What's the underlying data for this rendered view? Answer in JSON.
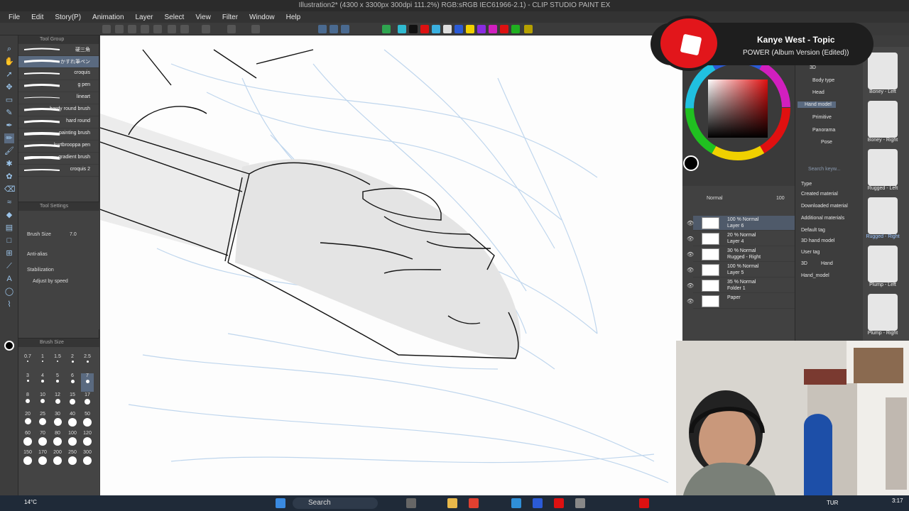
{
  "window": {
    "title": "Illustration2* (4300 x 3300px 300dpi 111.2%) RGB:sRGB IEC61966-2.1) - CLIP STUDIO PAINT EX"
  },
  "menu": [
    "File",
    "Edit",
    "Story(P)",
    "Animation",
    "Layer",
    "Select",
    "View",
    "Filter",
    "Window",
    "Help"
  ],
  "canvas_tab": "Illustration2*",
  "tool_panel": {
    "header": "Tool Group",
    "brushes": [
      "硬三角",
      "かすれ筆ペン",
      "croquis",
      "g pen",
      "lineart",
      "hardy round brush",
      "hard round",
      "painting brush",
      "kurtbrooppa pen",
      "gradient brush",
      "croquis 2"
    ],
    "selected_index": 1
  },
  "tool_settings": {
    "header": "Tool Settings",
    "brush_size_label": "Brush Size",
    "brush_size_value": "7.0",
    "antialias_label": "Anti-alias",
    "stabilization_label": "Stabilization",
    "adjust_label": "Adjust by speed"
  },
  "brush_size_panel": {
    "header": "Brush Size",
    "sizes": [
      "0.7",
      "1",
      "1.5",
      "2",
      "2.5",
      "3",
      "4",
      "5",
      "6",
      "7",
      "8",
      "10",
      "12",
      "15",
      "17",
      "20",
      "25",
      "30",
      "40",
      "50",
      "60",
      "70",
      "80",
      "100",
      "120",
      "150",
      "170",
      "200",
      "250",
      "300"
    ],
    "selected": "7"
  },
  "notification": {
    "title": "Kanye West - Topic",
    "subtitle": "POWER (Album Version (Edited))"
  },
  "layers": [
    {
      "opacity": "100 % Normal",
      "name": "Layer 6",
      "selected": true
    },
    {
      "opacity": "20 % Normal",
      "name": "Layer 4",
      "selected": false
    },
    {
      "opacity": "30 % Normal",
      "name": "Rugged - Right",
      "selected": false
    },
    {
      "opacity": "100 % Normal",
      "name": "Layer 5",
      "selected": false
    },
    {
      "opacity": "35 % Normal",
      "name": "Folder 1",
      "selected": false
    },
    {
      "opacity": "",
      "name": "Paper",
      "selected": false
    }
  ],
  "layer_blend": "Normal",
  "layer_opacity": "100",
  "material_panel": {
    "tree": [
      "3D",
      "Body type",
      "Head",
      "Hand model",
      "Primitive",
      "Panorama",
      "Pose"
    ],
    "selected": "Hand model",
    "search_placeholder": "Search keyw...",
    "tags": [
      "Type",
      "Created material",
      "Downloaded material",
      "Additional materials",
      "Default tag",
      "3D hand model",
      "User tag",
      "3D",
      "Hand",
      "Hand_model"
    ]
  },
  "hand_models": [
    {
      "label": "Boney - Left",
      "selected": false
    },
    {
      "label": "Boney - Right",
      "selected": false
    },
    {
      "label": "Rugged - Left",
      "selected": false
    },
    {
      "label": "Rugged - Right",
      "selected": true
    },
    {
      "label": "Plump - Left",
      "selected": false
    },
    {
      "label": "Plump - Right",
      "selected": false
    }
  ],
  "taskbar": {
    "weather": "14°C",
    "search": "Search",
    "lang": "TUR",
    "time": "3:17"
  },
  "colors": {
    "accent": "#9bc4ea",
    "notification_red": "#e2161b",
    "sketch_blue": "#b9d2ec"
  }
}
